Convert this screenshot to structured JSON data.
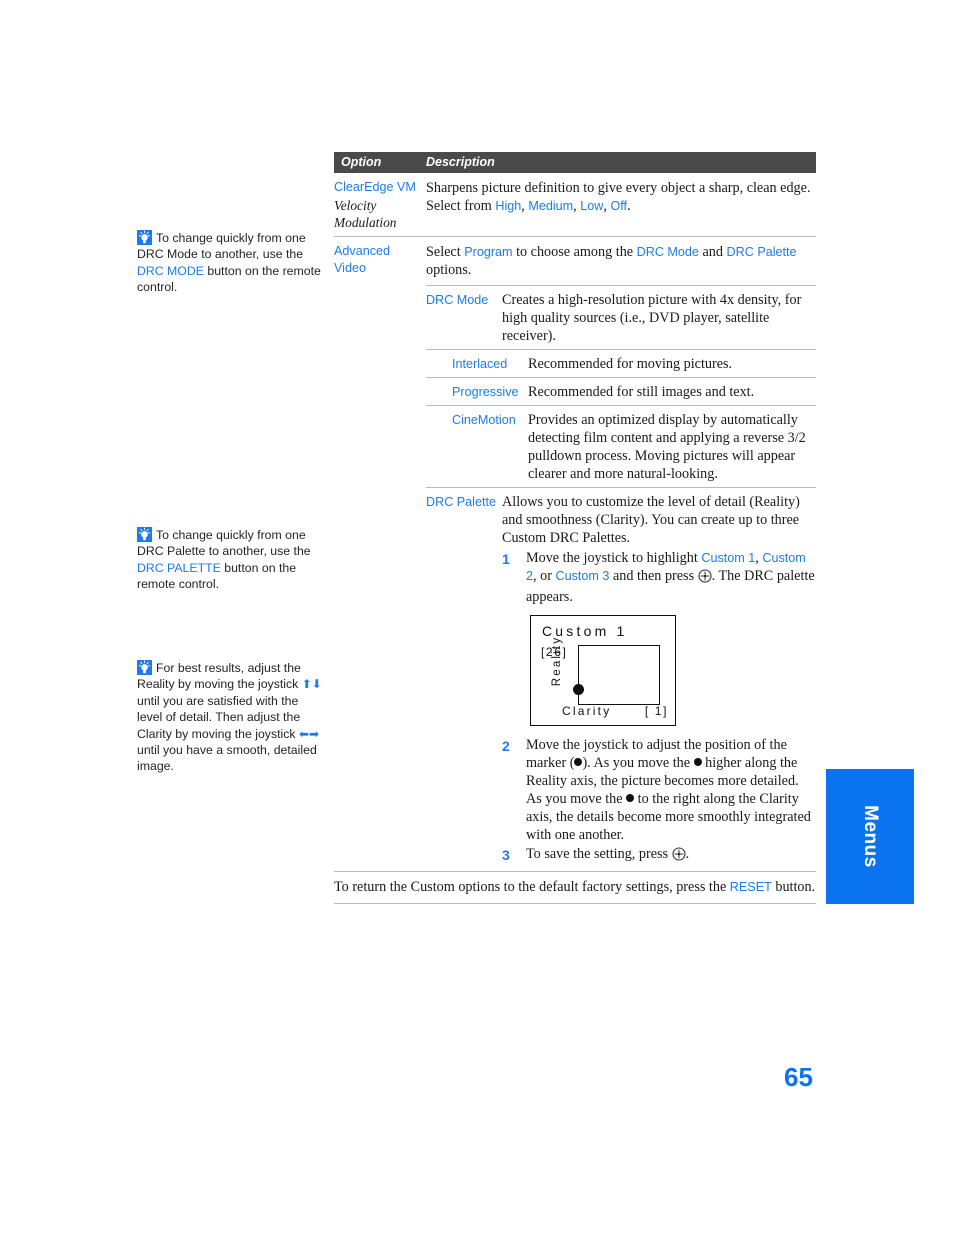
{
  "page": {
    "number": "65",
    "thumb_tab_label": "Menus",
    "accent_blue": "#1a7cf0",
    "header_bg": "#4a4a4a"
  },
  "table": {
    "header": {
      "option": "Option",
      "description": "Description"
    },
    "rows": [
      {
        "option_link": "ClearEdge VM",
        "option_italic_1": "Velocity",
        "option_italic_2": "Modulation",
        "desc_pre": "Sharpens picture definition to give every object a sharp, clean edge. Select from ",
        "desc_opts": [
          "High",
          "Medium",
          "Low",
          "Off"
        ],
        "desc_post": "."
      },
      {
        "option_link_1": "Advanced",
        "option_link_2": "Video",
        "desc_a": "Select ",
        "desc_link_program": "Program",
        "desc_b": " to choose among the ",
        "desc_link_mode": "DRC Mode",
        "desc_c": " and ",
        "desc_link_palette": "DRC Palette",
        "desc_d": " options."
      }
    ],
    "drc_mode": {
      "label": "DRC Mode",
      "description": "Creates a high-resolution picture with 4x density, for high quality sources (i.e., DVD player, satellite receiver).",
      "sub_rows": [
        {
          "label": "Interlaced",
          "description": "Recommended for moving pictures."
        },
        {
          "label": "Progressive",
          "description": "Recommended for still images and text."
        },
        {
          "label": "CineMotion",
          "description": "Provides an optimized display by automatically detecting film content and applying a reverse 3/2 pulldown process. Moving pictures will appear clearer and more natural-looking."
        }
      ]
    },
    "drc_palette": {
      "label": "DRC Palette",
      "description": "Allows you to customize the level of detail (Reality) and smoothness (Clarity). You can create up to three Custom DRC Palettes.",
      "steps": [
        {
          "num": "1",
          "text_a": "Move the joystick to highlight ",
          "link_1": "Custom 1",
          "text_b": ", ",
          "link_2": "Custom 2",
          "text_c": ", or ",
          "link_3": "Custom 3",
          "text_d": " and then press ",
          "icon": "joystick-center-icon",
          "text_e": ". The DRC palette appears."
        },
        {
          "num": "2",
          "text_a": "Move the joystick to adjust the position of the marker (",
          "text_b": "). As you move the ",
          "text_c": " higher along the Reality axis, the picture becomes more detailed. As you move the ",
          "text_d": " to the right along the Clarity axis, the details become more smoothly integrated with one another."
        },
        {
          "num": "3",
          "text_a": "To save the setting, press ",
          "icon": "joystick-center-icon",
          "text_b": "."
        }
      ],
      "diagram": {
        "title": "Custom  1",
        "value_top": "[26]",
        "axis_y": "Reality",
        "axis_x": "Clarity",
        "value_bottom": "[ 1]"
      }
    },
    "closing": {
      "text_a": "To return the Custom options to the default factory settings, press the ",
      "link": "RESET",
      "text_b": " button."
    }
  },
  "side_notes": [
    {
      "icon": "tip-lightbulb-icon",
      "text_a": "To change quickly from one DRC Mode to another, use the ",
      "link": "DRC MODE",
      "text_b": " button on the remote control."
    },
    {
      "icon": "tip-lightbulb-icon",
      "text_a": "To change quickly from one DRC Palette to another, use the ",
      "link": "DRC PALETTE",
      "text_b": " button on the remote control."
    },
    {
      "icon": "tip-lightbulb-icon",
      "text_a": "For best results, adjust the Reality by moving the joystick ",
      "arrow_up": "⬆",
      "arrow_down": "⬇",
      "text_b": " until you are satisfied with the level of detail. Then adjust the Clarity by moving the joystick ",
      "arrow_left": "⬅",
      "arrow_right": "➡",
      "text_c": " until you have a smooth, detailed image."
    }
  ]
}
